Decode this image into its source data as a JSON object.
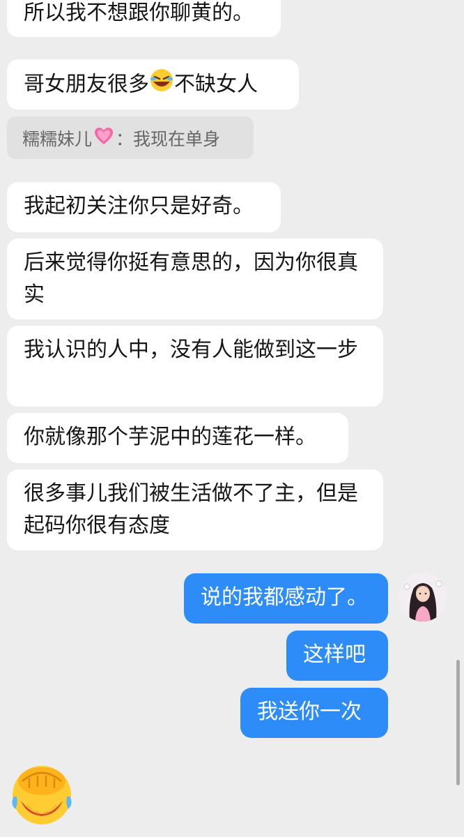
{
  "messages": {
    "m1": "所以我不想跟你聊黄的。",
    "m2a": "哥女朋友很多",
    "m2b": "不缺女人",
    "m3": "我起初关注你只是好奇。",
    "m4": "后来觉得你挺有意思的，因为你很真实",
    "m5": "我认识的人中，没有人能做到这一步",
    "m6": "你就像那个芋泥中的莲花一样。",
    "m7": "很多事儿我们被生活做不了主，但是起码你很有态度",
    "out1": "说的我都感动了。",
    "out2": "这样吧",
    "out3": "我送你一次"
  },
  "quote": {
    "sender": "糯糯妹儿",
    "separator": "：",
    "text": "我现在单身"
  },
  "icons": {
    "inline_emoji": "rolling-laughing-emoji",
    "heart": "pink-heart-emoji",
    "sticker": "facepalm-crying-sticker",
    "avatar": "user-avatar"
  },
  "colors": {
    "background": "#ededed",
    "incoming_bubble": "#ffffff",
    "outgoing_bubble": "#2d8cf8",
    "quote_bg": "#e1e1e1"
  }
}
